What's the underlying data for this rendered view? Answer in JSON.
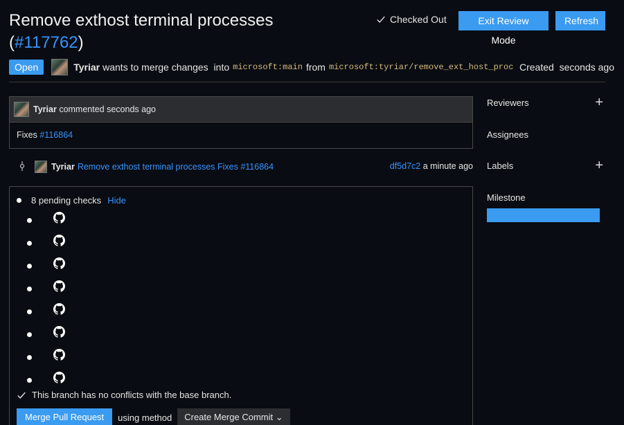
{
  "header": {
    "title": "Remove exthost terminal processes",
    "pr_number_open": "(",
    "pr_number": "#117762",
    "pr_number_close": ")",
    "checked_out_label": "Checked Out",
    "exit_review_label": "Exit Review Mode",
    "refresh_label": "Refresh"
  },
  "meta": {
    "status": "Open",
    "author": "Tyriar",
    "merge_text": "wants to merge changes",
    "into_text": "into",
    "base_branch": "microsoft:main",
    "from_text": "from",
    "head_branch": "microsoft:tyriar/remove_ext_host_proc",
    "created_label": "Created",
    "created_time": "seconds ago"
  },
  "comment": {
    "author": "Tyriar",
    "action": "commented seconds ago",
    "body_prefix": "Fixes",
    "body_link": "#116864"
  },
  "commit": {
    "author": "Tyriar",
    "message": "Remove exthost terminal processes Fixes #116864",
    "sha": "df5d7c2",
    "time": "a minute ago"
  },
  "checks": {
    "summary": "8 pending checks",
    "toggle_label": "Hide",
    "items": [
      "github-icon",
      "github-icon",
      "github-icon",
      "github-icon",
      "github-icon",
      "github-icon",
      "github-icon",
      "github-icon"
    ],
    "no_conflicts": "This branch has no conflicts with the base branch.",
    "merge_button": "Merge Pull Request",
    "using_method": "using method",
    "method": "Create Merge Commit"
  },
  "sidebar": {
    "reviewers": "Reviewers",
    "assignees": "Assignees",
    "labels": "Labels",
    "milestone": "Milestone"
  },
  "colors": {
    "accent": "#3a9bf0",
    "link": "#3794ff",
    "background": "#090c12",
    "branch": "#d7ba7d"
  }
}
